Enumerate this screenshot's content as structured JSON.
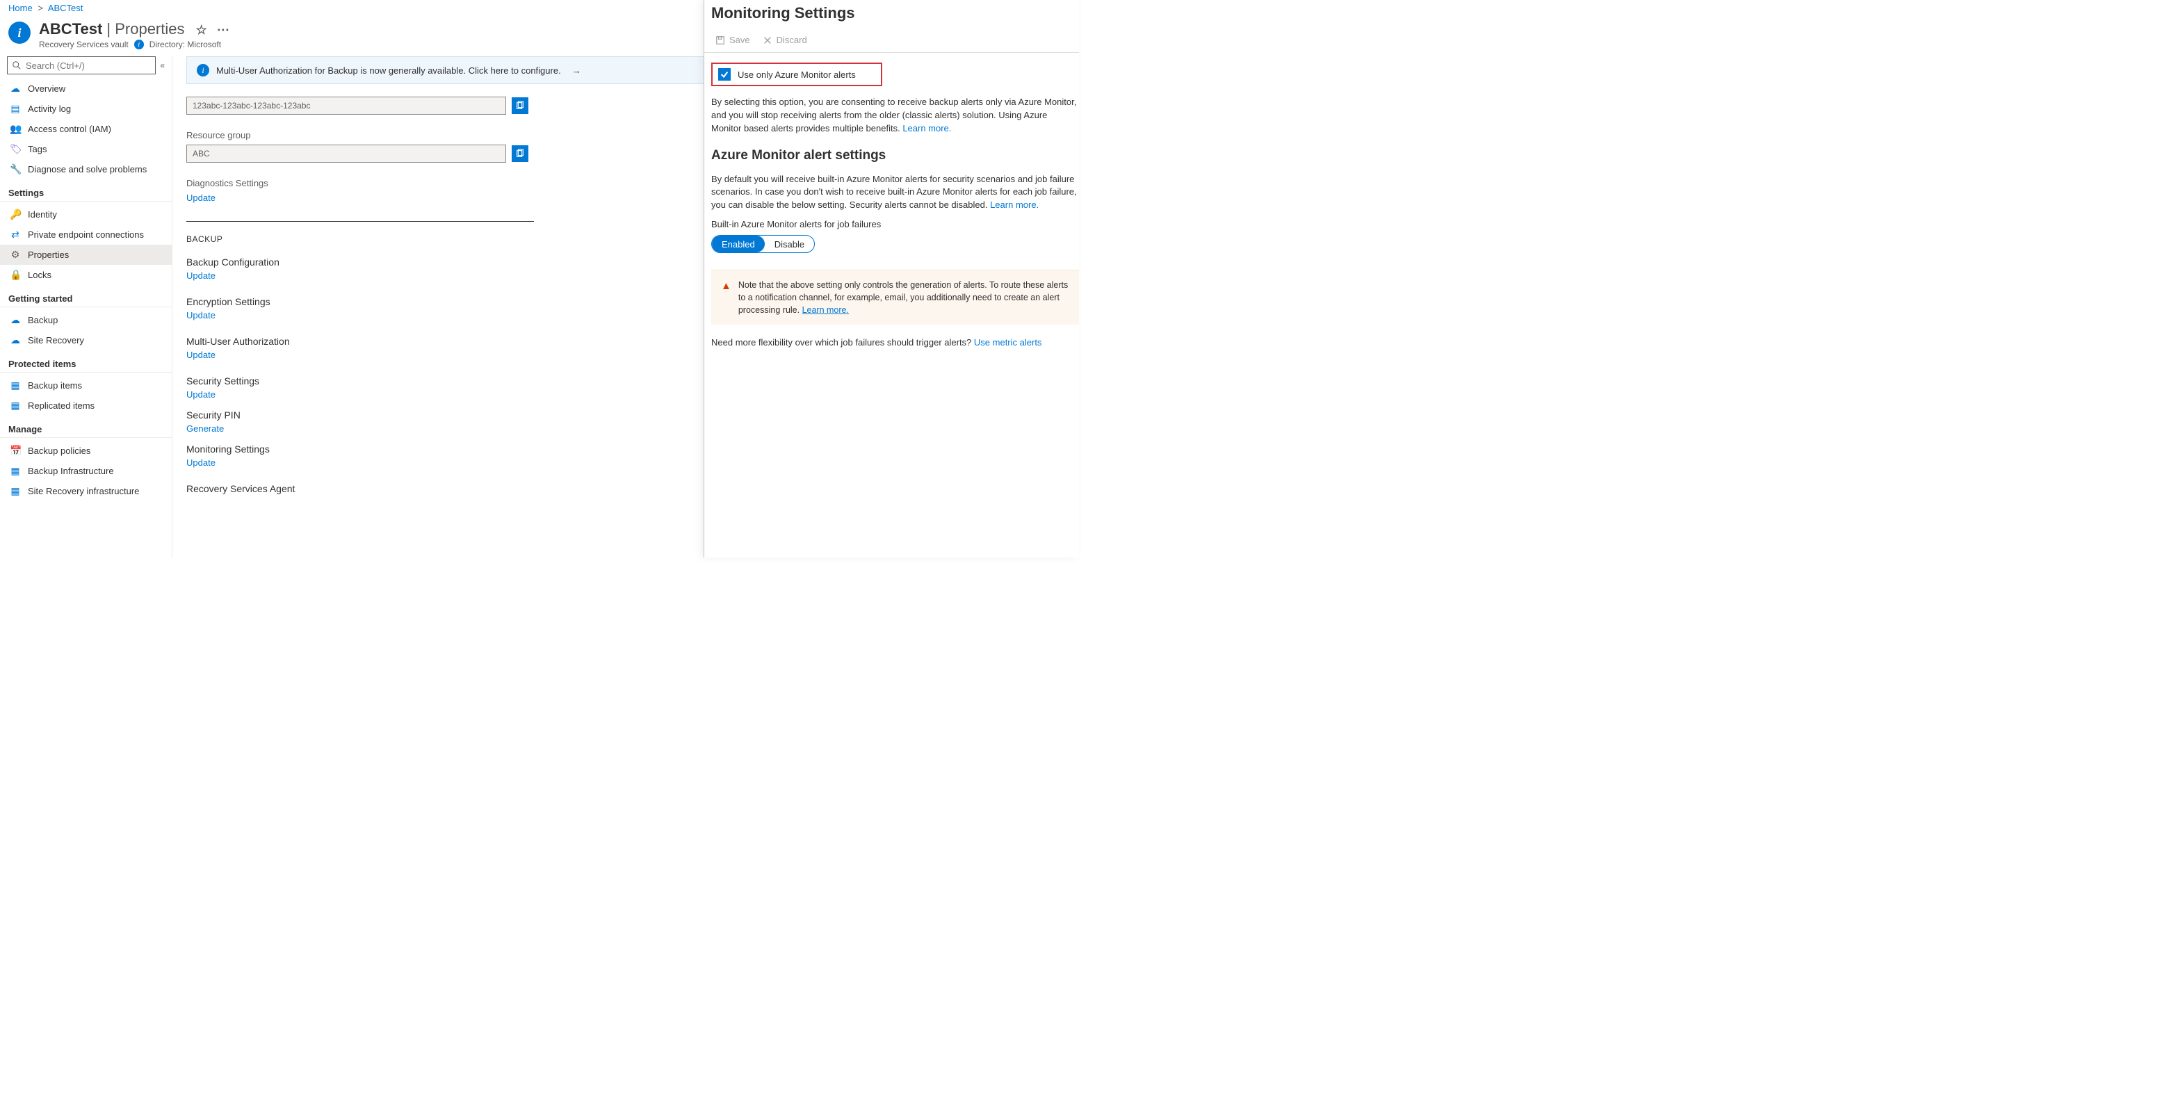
{
  "breadcrumb": {
    "home": "Home",
    "resource": "ABCTest"
  },
  "header": {
    "title_resource": "ABCTest",
    "title_section": "Properties",
    "subtitle_type": "Recovery Services vault",
    "subtitle_directory_label": "Directory:",
    "subtitle_directory_value": "Microsoft"
  },
  "search": {
    "placeholder": "Search (Ctrl+/)"
  },
  "nav": {
    "items": [
      "Overview",
      "Activity log",
      "Access control (IAM)",
      "Tags",
      "Diagnose and solve problems"
    ],
    "section_settings": "Settings",
    "settings_items": [
      "Identity",
      "Private endpoint connections",
      "Properties",
      "Locks"
    ],
    "section_getting_started": "Getting started",
    "gs_items": [
      "Backup",
      "Site Recovery"
    ],
    "section_protected": "Protected items",
    "protected_items": [
      "Backup items",
      "Replicated items"
    ],
    "section_manage": "Manage",
    "manage_items": [
      "Backup policies",
      "Backup Infrastructure",
      "Site Recovery infrastructure"
    ]
  },
  "banner": {
    "text": "Multi-User Authorization for Backup is now generally available. Click here to configure."
  },
  "main": {
    "sub_id_value": "123abc-123abc-123abc-123abc",
    "rg_label": "Resource group",
    "rg_value": "ABC",
    "diag_label": "Diagnostics Settings",
    "update": "Update",
    "section_backup": "BACKUP",
    "backup_config": "Backup Configuration",
    "encryption": "Encryption Settings",
    "mua": "Multi-User Authorization",
    "security": "Security Settings",
    "security_pin": "Security PIN",
    "generate": "Generate",
    "monitoring": "Monitoring Settings",
    "rsa": "Recovery Services Agent"
  },
  "panel": {
    "title": "Monitoring Settings",
    "save": "Save",
    "discard": "Discard",
    "checkbox_label": "Use only Azure Monitor alerts",
    "desc1_a": "By selecting this option, you are consenting to receive backup alerts only via Azure Monitor, and you will stop receiving alerts from the older (classic alerts) solution. Using Azure Monitor based alerts provides multiple benefits. ",
    "learn_more": "Learn more.",
    "h3": "Azure Monitor alert settings",
    "desc2_a": "By default you will receive built-in Azure Monitor alerts for security scenarios and job failure scenarios. In case you don't wish to receive built-in Azure Monitor alerts for each job failure, you can disable the below setting. Security alerts cannot be disabled. ",
    "toggle_label": "Built-in Azure Monitor alerts for job failures",
    "enabled": "Enabled",
    "disable": "Disable",
    "note": "Note that the above setting only controls the generation of alerts. To route these alerts to a notification channel, for example, email, you additionally need to create an alert processing rule. ",
    "footer_q": "Need more flexibility over which job failures should trigger alerts? ",
    "footer_link": "Use metric alerts"
  }
}
